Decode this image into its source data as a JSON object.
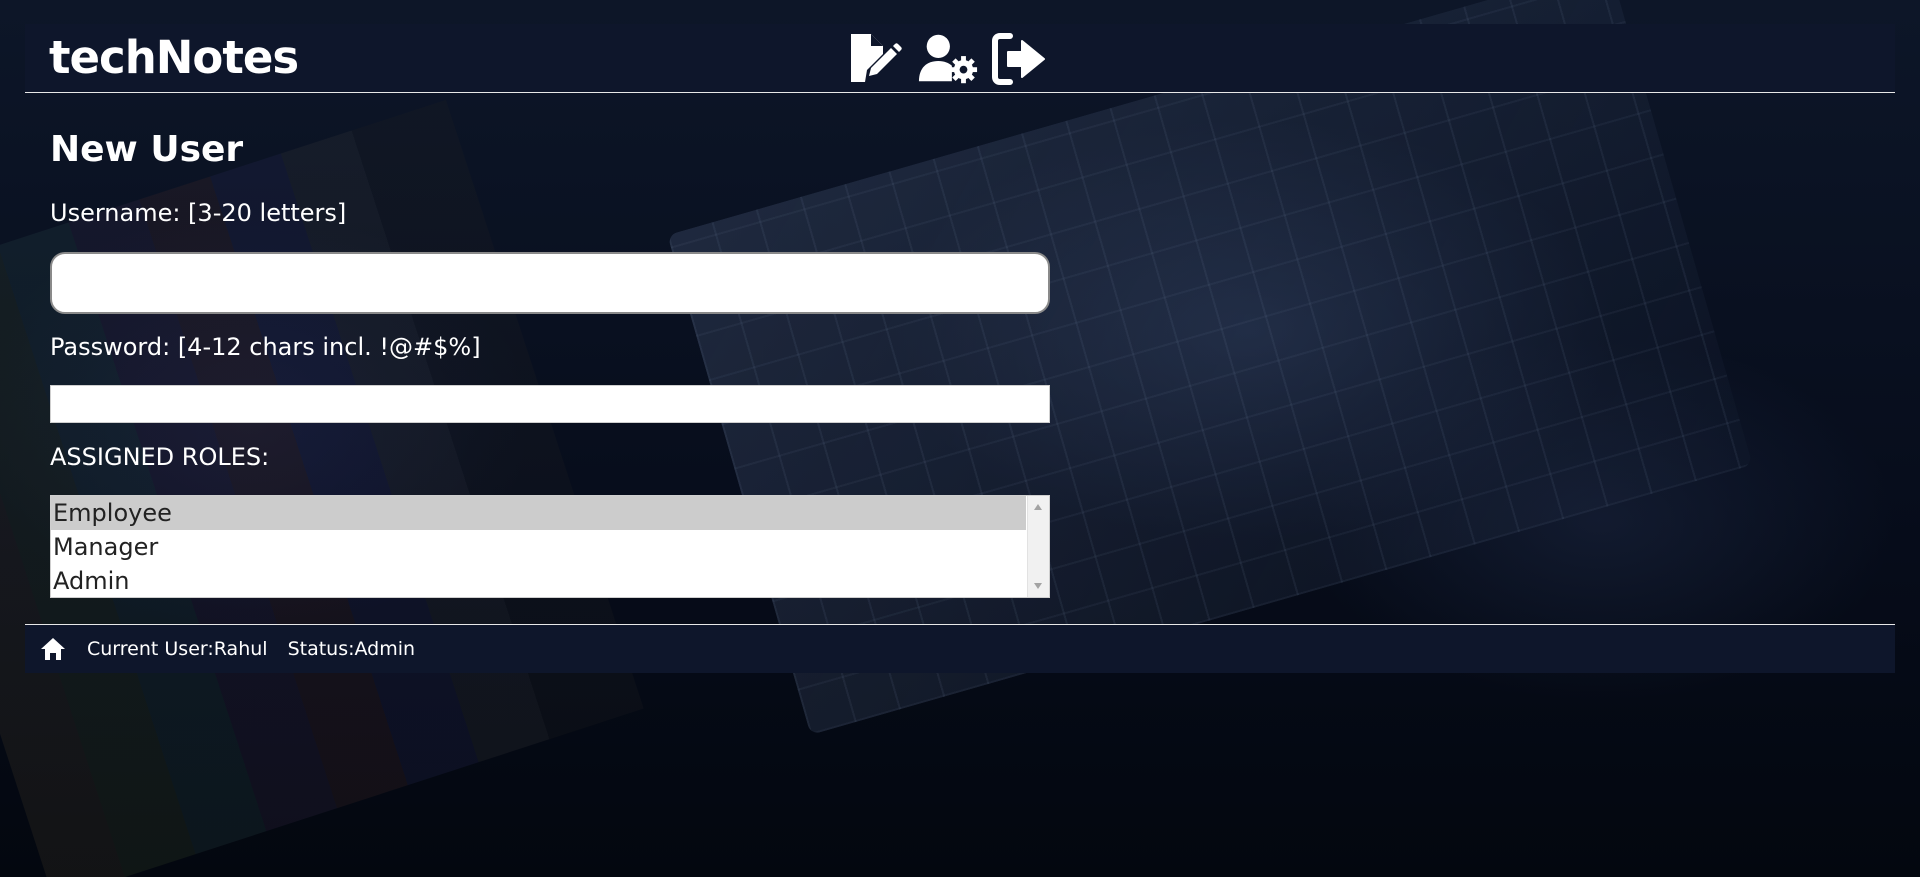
{
  "header": {
    "title": "techNotes",
    "nav": [
      {
        "icon": "file-pen-icon",
        "action": "new-note"
      },
      {
        "icon": "user-gear-icon",
        "action": "user-settings"
      },
      {
        "icon": "logout-icon",
        "action": "logout"
      }
    ]
  },
  "form": {
    "title": "New User",
    "username_label": "Username: [3-20 letters]",
    "username_value": "",
    "password_label": "Password: [4-12 chars incl. !@#$%]",
    "password_value": "",
    "roles_label": "ASSIGNED ROLES:",
    "roles": [
      {
        "label": "Employee",
        "selected": true
      },
      {
        "label": "Manager",
        "selected": false
      },
      {
        "label": "Admin",
        "selected": false
      }
    ]
  },
  "footer": {
    "home_icon": "home-icon",
    "current_user": "Current User:Rahul",
    "status": "Status:Admin"
  },
  "colors": {
    "bar_background": "#0e162b",
    "page_background": "#050a17",
    "text": "#ffffff",
    "selected_option": "#cccccc"
  }
}
